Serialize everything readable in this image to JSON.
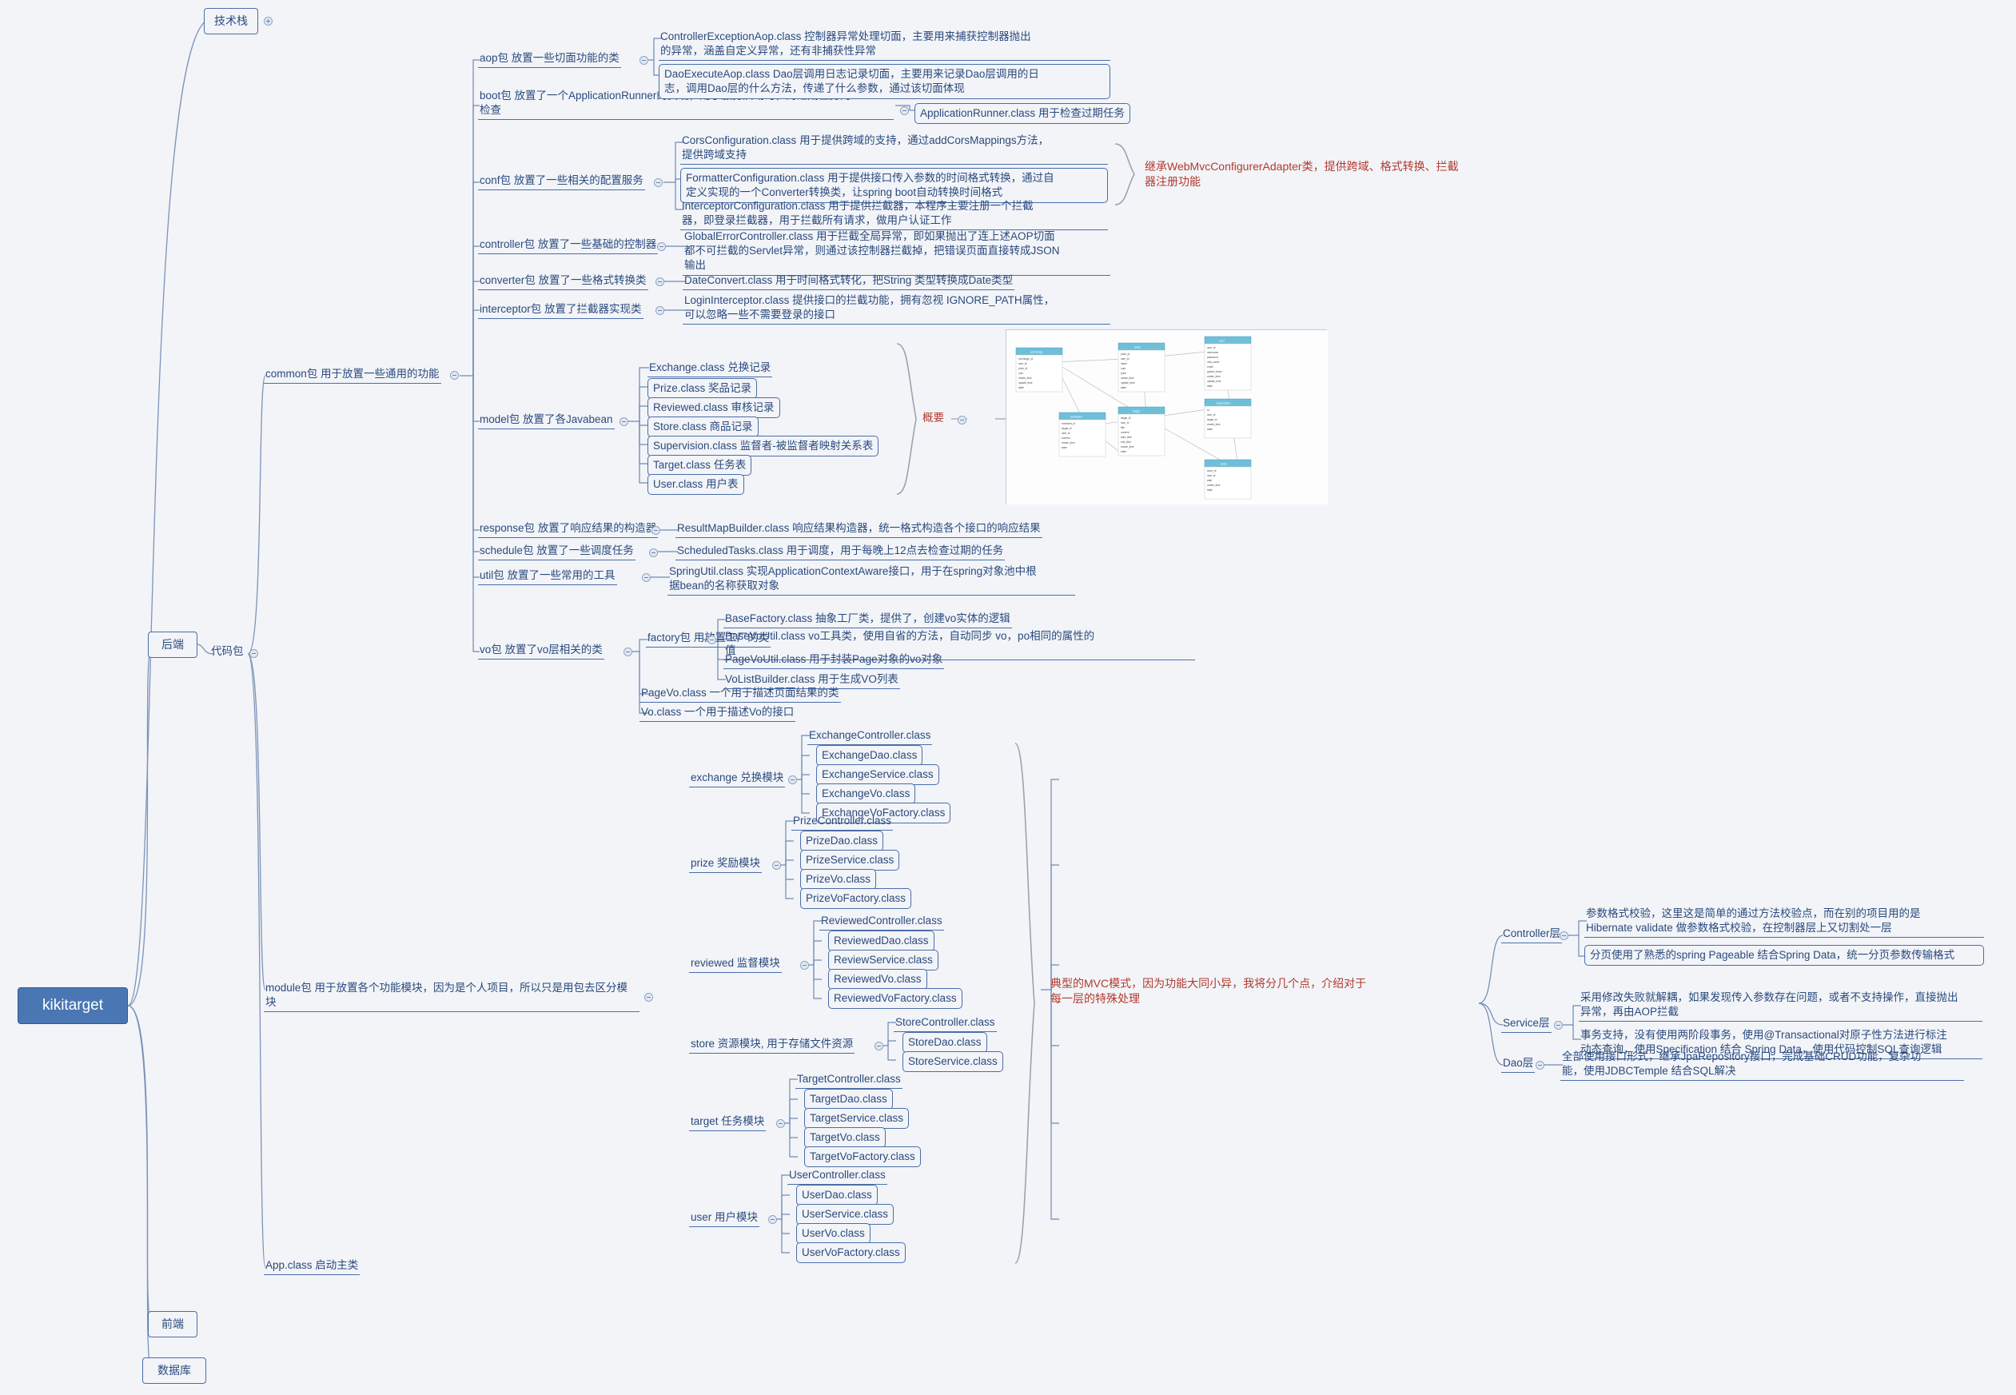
{
  "root": {
    "label": "kikitarget"
  },
  "branches": [
    {
      "label": "技术栈"
    },
    {
      "label": "后端"
    },
    {
      "label": "前端"
    },
    {
      "label": "数据库"
    }
  ],
  "level2": [
    {
      "label": "代码包"
    }
  ],
  "packages": [
    {
      "label": "common包 用于放置一些通用的功能"
    },
    {
      "label": "module包 用于放置各个功能模块，因为是个人项目，所以只是用包去区分模块"
    },
    {
      "label": "App.class 启动主类"
    }
  ],
  "common_children": [
    {
      "label": "aop包 放置一些切面功能的类"
    },
    {
      "label": "boot包 放置了一个ApplicationRunner的实现，用于服务启动时，对过期任务的\n检查"
    },
    {
      "label": "conf包 放置了一些相关的配置服务"
    },
    {
      "label": "controller包 放置了一些基础的控制器"
    },
    {
      "label": "converter包 放置了一些格式转换类"
    },
    {
      "label": "interceptor包 放置了拦截器实现类"
    },
    {
      "label": "model包 放置了各Javabean"
    },
    {
      "label": "response包 放置了响应结果的构造器"
    },
    {
      "label": "schedule包 放置了一些调度任务"
    },
    {
      "label": "util包 放置了一些常用的工具"
    },
    {
      "label": "vo包 放置了vo层相关的类"
    }
  ],
  "aop_classes": [
    "ControllerExceptionAop.class 控制器异常处理切面，主要用来捕获控制器抛出\n的异常，涵盖自定义异常，还有非捕获性异常",
    "DaoExecuteAop.class Dao层调用日志记录切面，主要用来记录Dao层调用的日\n志，调用Dao层的什么方法，传递了什么参数，通过该切面体现"
  ],
  "boot_classes": [
    "ApplicationRunner.class 用于检查过期任务"
  ],
  "conf_classes": [
    "CorsConfiguration.class 用于提供跨域的支持，通过addCorsMappings方法，\n提供跨域支持",
    "FormatterConfiguration.class 用于提供接口传入参数的时间格式转换，通过自\n定义实现的一个Converter转换类，让spring boot自动转换时间格式",
    "InterceptorConfiguration.class 用于提供拦截器，本程序主要注册一个拦截\n器，即登录拦截器，用于拦截所有请求，做用户认证工作"
  ],
  "conf_note": "继承WebMvcConfigurerAdapter类，提供跨域、格式转换、拦截\n器注册功能",
  "controller_classes": [
    "GlobalErrorController.class 用于拦截全局异常，即如果抛出了连上述AOP切面\n都不可拦截的Servlet异常，则通过该控制器拦截掉，把错误页面直接转成JSON\n输出"
  ],
  "converter_classes": [
    "DateConvert.class 用于时间格式转化，把String 类型转换成Date类型"
  ],
  "interceptor_classes": [
    "LoginInterceptor.class 提供接口的拦截功能，拥有忽视 IGNORE_PATH属性，\n可以忽略一些不需要登录的接口"
  ],
  "model_classes": [
    "Exchange.class 兑换记录",
    "Prize.class 奖品记录",
    "Reviewed.class 审核记录",
    "Store.class 商品记录",
    "Supervision.class 监督者-被监督者映射关系表",
    "Target.class 任务表",
    "User.class 用户表"
  ],
  "model_note": "概要",
  "response_classes": [
    "ResultMapBuilder.class 响应结果构造器，统一格式构造各个接口的响应结果"
  ],
  "schedule_classes": [
    "ScheduledTasks.class 用于调度，用于每晚上12点去检查过期的任务"
  ],
  "util_classes": [
    "SpringUtil.class 实现ApplicationContextAware接口，用于在spring对象池中根\n据bean的名称获取对象"
  ],
  "vo_children": [
    {
      "label": "factory包 用放置工厂的类"
    },
    {
      "label": "PageVo.class 一个用于描述页面结果的类"
    },
    {
      "label": "Vo.class 一个用于描述Vo的接口"
    }
  ],
  "factory_classes": [
    "BaseFactory.class 抽象工厂类，提供了，创建vo实体的逻辑",
    "BaseVoUtil.class vo工具类，使用自省的方法，自动同步 vo，po相同的属性的\n值",
    "PageVoUtil.class 用于封装Page对象的vo对象",
    "VoListBuilder.class 用于生成VO列表"
  ],
  "modules": [
    {
      "label": "exchange 兑换模块",
      "classes": [
        "ExchangeController.class",
        "ExchangeDao.class",
        "ExchangeService.class",
        "ExchangeVo.class",
        "ExchangeVoFactory.class"
      ]
    },
    {
      "label": "prize 奖励模块",
      "classes": [
        "PrizeController.class",
        "PrizeDao.class",
        "PrizeService.class",
        "PrizeVo.class",
        "PrizeVoFactory.class"
      ]
    },
    {
      "label": "reviewed 监督模块",
      "classes": [
        "ReviewedController.class",
        "ReviewedDao.class",
        "ReviewService.class",
        "ReviewedVo.class",
        "ReviewedVoFactory.class"
      ]
    },
    {
      "label": "store 资源模块, 用于存储文件资源",
      "classes": [
        "StoreController.class",
        "StoreDao.class",
        "StoreService.class"
      ]
    },
    {
      "label": "target 任务模块",
      "classes": [
        "TargetController.class",
        "TargetDao.class",
        "TargetService.class",
        "TargetVo.class",
        "TargetVoFactory.class"
      ]
    },
    {
      "label": "user 用户模块",
      "classes": [
        "UserController.class",
        "UserDao.class",
        "UserService.class",
        "UserVo.class",
        "UserVoFactory.class"
      ]
    }
  ],
  "mvc_note": "典型的MVC模式，因为功能大同小异，我将分几个点，介绍对于\n每一层的特殊处理",
  "mvc_layers": [
    {
      "label": "Controller层",
      "points": [
        "参数格式校验，这里这是简单的通过方法校验点，而在别的项目用的是\nHibernate validate 做参数格式校验，在控制器层上又切割处一层",
        "分页使用了熟悉的spring Pageable 结合Spring Data，统一分页参数传输格式"
      ]
    },
    {
      "label": "Service层",
      "points": [
        "采用修改失败就解耦，如果发现传入参数存在问题，或者不支持操作，直接抛出\n异常，再由AOP拦截",
        "事务支持，没有使用两阶段事务，使用@Transactional对原子性方法进行标注\n动态查询，使用Specification 结合 Spring Data，使用代码控制SQL查询逻辑"
      ]
    },
    {
      "label": "Dao层",
      "points": [
        "全部使用接口形式，继承JpaRepository接口，完成基础CRUD功能，复杂功\n能，使用JDBCTemple 结合SQL解决"
      ]
    }
  ]
}
